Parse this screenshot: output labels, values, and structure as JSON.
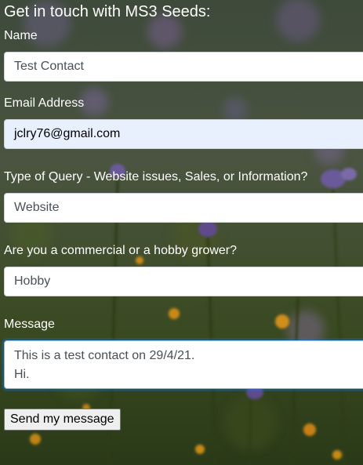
{
  "page": {
    "heading": "Get in touch with MS3 Seeds:"
  },
  "form": {
    "name": {
      "label": "Name",
      "value": "Test Contact"
    },
    "email": {
      "label": "Email Address",
      "value": "jclry76@gmail.com"
    },
    "query_type": {
      "label": "Type of Query - Website issues, Sales, or Information?",
      "value": "Website"
    },
    "grower_type": {
      "label": "Are you a commercial or a hobby grower?",
      "value": "Hobby"
    },
    "message": {
      "label": "Message",
      "lines": [
        "This is a test contact on 29/4/21.",
        "Hi."
      ]
    },
    "submit_label": "Send my message"
  },
  "colors": {
    "focus_border": "#80bdff",
    "autofill_bg": "#e8f0fe",
    "label_text": "#ffffff"
  }
}
